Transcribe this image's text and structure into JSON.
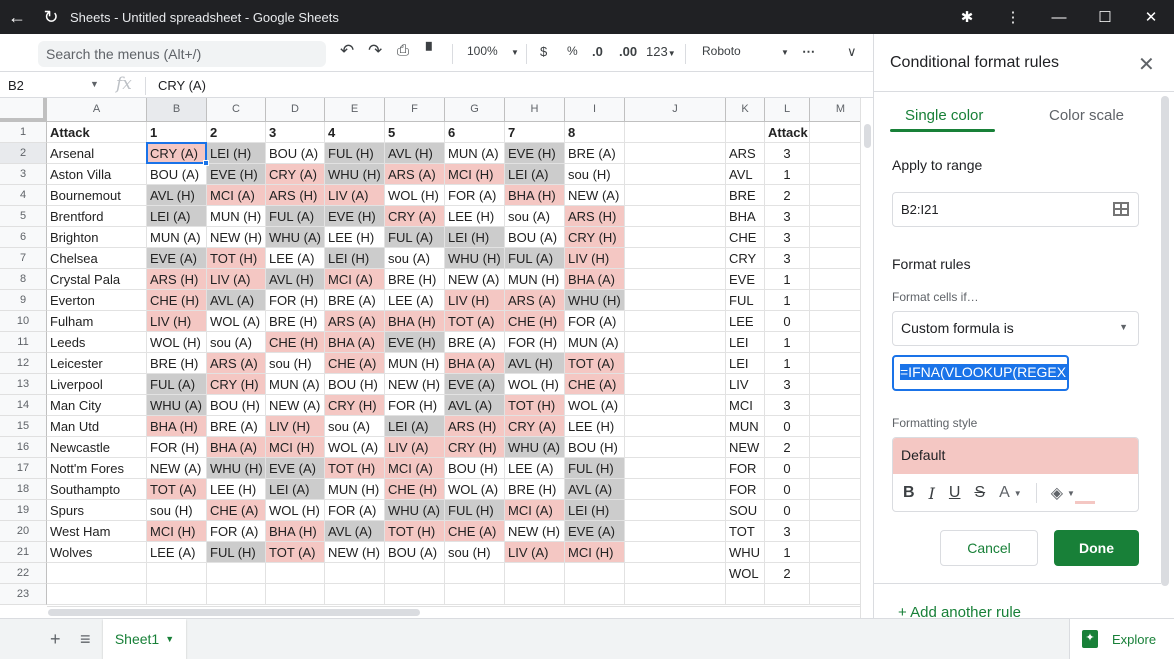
{
  "window": {
    "title": "Sheets - Untitled spreadsheet - Google Sheets",
    "icons": [
      "back-arrow-icon",
      "reload-icon",
      "extensions-icon",
      "more-vert-icon",
      "minimize-icon",
      "maximize-icon",
      "close-icon"
    ]
  },
  "toolbar": {
    "search_placeholder": "Search the menus (Alt+/)",
    "zoom": "100%",
    "currency": "$",
    "percent": "%",
    "decrease_decimal": ".0",
    "increase_decimal": ".00",
    "number_format": "123",
    "font": "Roboto",
    "more": "⋯",
    "collapse": "∨"
  },
  "formula_bar": {
    "name_box": "B2",
    "fx": "fx",
    "value": "CRY (A)"
  },
  "grid": {
    "columns": [
      "A",
      "B",
      "C",
      "D",
      "E",
      "F",
      "G",
      "H",
      "I",
      "J",
      "K",
      "L",
      "M"
    ],
    "selected_column": "B",
    "selected_row": 2,
    "row_numbers": [
      1,
      2,
      3,
      4,
      5,
      6,
      7,
      8,
      9,
      10,
      11,
      12,
      13,
      14,
      15,
      16,
      17,
      18,
      19,
      20,
      21,
      22,
      23
    ],
    "header_row": [
      "Attack",
      "1",
      "2",
      "3",
      "4",
      "5",
      "6",
      "7",
      "8"
    ],
    "fixture_rows": [
      {
        "team": "Arsenal",
        "cells": [
          [
            "CRY (A)",
            "p"
          ],
          [
            "LEI (H)",
            "g"
          ],
          [
            "BOU (A)",
            ""
          ],
          [
            "FUL (H)",
            "g"
          ],
          [
            "AVL (H)",
            "g"
          ],
          [
            "MUN (A)",
            ""
          ],
          [
            "EVE (H)",
            "g"
          ],
          [
            "BRE (A)",
            ""
          ]
        ]
      },
      {
        "team": "Aston Villa",
        "cells": [
          [
            "BOU (A)",
            ""
          ],
          [
            "EVE (H)",
            "g"
          ],
          [
            "CRY (A)",
            "p"
          ],
          [
            "WHU (H)",
            "g"
          ],
          [
            "ARS (A)",
            "p"
          ],
          [
            "MCI (H)",
            "p"
          ],
          [
            "LEI (A)",
            "g"
          ],
          [
            "sou (H)",
            ""
          ]
        ]
      },
      {
        "team": "Bournemout",
        "cells": [
          [
            "AVL (H)",
            "g"
          ],
          [
            "MCI (A)",
            "p"
          ],
          [
            "ARS (H)",
            "p"
          ],
          [
            "LIV (A)",
            "p"
          ],
          [
            "WOL (H)",
            ""
          ],
          [
            "FOR (A)",
            ""
          ],
          [
            "BHA (H)",
            "p"
          ],
          [
            "NEW (A)",
            ""
          ]
        ]
      },
      {
        "team": "Brentford",
        "cells": [
          [
            "LEI (A)",
            "g"
          ],
          [
            "MUN (H)",
            ""
          ],
          [
            "FUL (A)",
            "g"
          ],
          [
            "EVE (H)",
            "g"
          ],
          [
            "CRY (A)",
            "p"
          ],
          [
            "LEE (H)",
            ""
          ],
          [
            "sou (A)",
            ""
          ],
          [
            "ARS (H)",
            "p"
          ]
        ]
      },
      {
        "team": "Brighton",
        "cells": [
          [
            "MUN (A)",
            ""
          ],
          [
            "NEW (H)",
            ""
          ],
          [
            "WHU (A)",
            "g"
          ],
          [
            "LEE (H)",
            ""
          ],
          [
            "FUL (A)",
            "g"
          ],
          [
            "LEI (H)",
            "g"
          ],
          [
            "BOU (A)",
            ""
          ],
          [
            "CRY (H)",
            "p"
          ]
        ]
      },
      {
        "team": "Chelsea",
        "cells": [
          [
            "EVE (A)",
            "g"
          ],
          [
            "TOT (H)",
            "p"
          ],
          [
            "LEE (A)",
            ""
          ],
          [
            "LEI (H)",
            "g"
          ],
          [
            "sou (A)",
            ""
          ],
          [
            "WHU (H)",
            "g"
          ],
          [
            "FUL (A)",
            "g"
          ],
          [
            "LIV (H)",
            "p"
          ]
        ]
      },
      {
        "team": "Crystal Pala",
        "cells": [
          [
            "ARS (H)",
            "p"
          ],
          [
            "LIV (A)",
            "p"
          ],
          [
            "AVL (H)",
            "g"
          ],
          [
            "MCI (A)",
            "p"
          ],
          [
            "BRE (H)",
            ""
          ],
          [
            "NEW (A)",
            ""
          ],
          [
            "MUN (H)",
            ""
          ],
          [
            "BHA (A)",
            "p"
          ]
        ]
      },
      {
        "team": "Everton",
        "cells": [
          [
            "CHE (H)",
            "p"
          ],
          [
            "AVL (A)",
            "g"
          ],
          [
            "FOR (H)",
            ""
          ],
          [
            "BRE (A)",
            ""
          ],
          [
            "LEE (A)",
            ""
          ],
          [
            "LIV (H)",
            "p"
          ],
          [
            "ARS (A)",
            "p"
          ],
          [
            "WHU (H)",
            "g"
          ]
        ]
      },
      {
        "team": "Fulham",
        "cells": [
          [
            "LIV (H)",
            "p"
          ],
          [
            "WOL (A)",
            ""
          ],
          [
            "BRE (H)",
            ""
          ],
          [
            "ARS (A)",
            "p"
          ],
          [
            "BHA (H)",
            "p"
          ],
          [
            "TOT (A)",
            "p"
          ],
          [
            "CHE (H)",
            "p"
          ],
          [
            "FOR (A)",
            ""
          ]
        ]
      },
      {
        "team": "Leeds",
        "cells": [
          [
            "WOL (H)",
            ""
          ],
          [
            "sou (A)",
            ""
          ],
          [
            "CHE (H)",
            "p"
          ],
          [
            "BHA (A)",
            "p"
          ],
          [
            "EVE (H)",
            "g"
          ],
          [
            "BRE (A)",
            ""
          ],
          [
            "FOR (H)",
            ""
          ],
          [
            "MUN (A)",
            ""
          ]
        ]
      },
      {
        "team": "Leicester",
        "cells": [
          [
            "BRE (H)",
            ""
          ],
          [
            "ARS (A)",
            "p"
          ],
          [
            "sou (H)",
            ""
          ],
          [
            "CHE (A)",
            "p"
          ],
          [
            "MUN (H)",
            ""
          ],
          [
            "BHA (A)",
            "p"
          ],
          [
            "AVL (H)",
            "g"
          ],
          [
            "TOT (A)",
            "p"
          ]
        ]
      },
      {
        "team": "Liverpool",
        "cells": [
          [
            "FUL (A)",
            "g"
          ],
          [
            "CRY (H)",
            "p"
          ],
          [
            "MUN (A)",
            ""
          ],
          [
            "BOU (H)",
            ""
          ],
          [
            "NEW (H)",
            ""
          ],
          [
            "EVE (A)",
            "g"
          ],
          [
            "WOL (H)",
            ""
          ],
          [
            "CHE (A)",
            "p"
          ]
        ]
      },
      {
        "team": "Man City",
        "cells": [
          [
            "WHU (A)",
            "g"
          ],
          [
            "BOU (H)",
            ""
          ],
          [
            "NEW (A)",
            ""
          ],
          [
            "CRY (H)",
            "p"
          ],
          [
            "FOR (H)",
            ""
          ],
          [
            "AVL (A)",
            "g"
          ],
          [
            "TOT (H)",
            "p"
          ],
          [
            "WOL (A)",
            ""
          ]
        ]
      },
      {
        "team": "Man Utd",
        "cells": [
          [
            "BHA (H)",
            "p"
          ],
          [
            "BRE (A)",
            ""
          ],
          [
            "LIV (H)",
            "p"
          ],
          [
            "sou (A)",
            ""
          ],
          [
            "LEI (A)",
            "g"
          ],
          [
            "ARS (H)",
            "p"
          ],
          [
            "CRY (A)",
            "p"
          ],
          [
            "LEE (H)",
            ""
          ]
        ]
      },
      {
        "team": "Newcastle",
        "cells": [
          [
            "FOR (H)",
            ""
          ],
          [
            "BHA (A)",
            "p"
          ],
          [
            "MCI (H)",
            "p"
          ],
          [
            "WOL (A)",
            ""
          ],
          [
            "LIV (A)",
            "p"
          ],
          [
            "CRY (H)",
            "p"
          ],
          [
            "WHU (A)",
            "g"
          ],
          [
            "BOU (H)",
            ""
          ]
        ]
      },
      {
        "team": "Nott'm Fores",
        "cells": [
          [
            "NEW (A)",
            ""
          ],
          [
            "WHU (H)",
            "g"
          ],
          [
            "EVE (A)",
            "g"
          ],
          [
            "TOT (H)",
            "p"
          ],
          [
            "MCI (A)",
            "p"
          ],
          [
            "BOU (H)",
            ""
          ],
          [
            "LEE (A)",
            ""
          ],
          [
            "FUL (H)",
            "g"
          ]
        ]
      },
      {
        "team": "Southampto",
        "cells": [
          [
            "TOT (A)",
            "p"
          ],
          [
            "LEE (H)",
            ""
          ],
          [
            "LEI (A)",
            "g"
          ],
          [
            "MUN (H)",
            ""
          ],
          [
            "CHE (H)",
            "p"
          ],
          [
            "WOL (A)",
            ""
          ],
          [
            "BRE (H)",
            ""
          ],
          [
            "AVL (A)",
            "g"
          ]
        ]
      },
      {
        "team": "Spurs",
        "cells": [
          [
            "sou (H)",
            ""
          ],
          [
            "CHE (A)",
            "p"
          ],
          [
            "WOL (H)",
            ""
          ],
          [
            "FOR (A)",
            ""
          ],
          [
            "WHU (A)",
            "g"
          ],
          [
            "FUL (H)",
            "g"
          ],
          [
            "MCI (A)",
            "p"
          ],
          [
            "LEI (H)",
            "g"
          ]
        ]
      },
      {
        "team": "West Ham",
        "cells": [
          [
            "MCI (H)",
            "p"
          ],
          [
            "FOR (A)",
            ""
          ],
          [
            "BHA (H)",
            "p"
          ],
          [
            "AVL (A)",
            "g"
          ],
          [
            "TOT (H)",
            "p"
          ],
          [
            "CHE (A)",
            "p"
          ],
          [
            "NEW (H)",
            ""
          ],
          [
            "EVE (A)",
            "g"
          ]
        ]
      },
      {
        "team": "Wolves",
        "cells": [
          [
            "LEE (A)",
            ""
          ],
          [
            "FUL (H)",
            "g"
          ],
          [
            "TOT (A)",
            "p"
          ],
          [
            "NEW (H)",
            ""
          ],
          [
            "BOU (A)",
            ""
          ],
          [
            "sou (H)",
            ""
          ],
          [
            "LIV (A)",
            "p"
          ],
          [
            "MCI (H)",
            "p"
          ]
        ]
      }
    ],
    "lookup_header": "Attack",
    "lookup": [
      [
        "ARS",
        3
      ],
      [
        "AVL",
        1
      ],
      [
        "BRE",
        2
      ],
      [
        "BHA",
        3
      ],
      [
        "CHE",
        3
      ],
      [
        "CRY",
        3
      ],
      [
        "EVE",
        1
      ],
      [
        "FUL",
        1
      ],
      [
        "LEE",
        0
      ],
      [
        "LEI",
        1
      ],
      [
        "LEI",
        1
      ],
      [
        "LIV",
        3
      ],
      [
        "MCI",
        3
      ],
      [
        "MUN",
        0
      ],
      [
        "NEW",
        2
      ],
      [
        "FOR",
        0
      ],
      [
        "FOR",
        0
      ],
      [
        "SOU",
        0
      ],
      [
        "TOT",
        3
      ],
      [
        "WHU",
        1
      ],
      [
        "WOL",
        2
      ]
    ],
    "fill_colors": {
      "p": "#f4c7c3",
      "g": "#cccccc"
    }
  },
  "sheets": {
    "tabs": [
      {
        "label": "Sheet1",
        "active": true
      }
    ],
    "explore_label": "Explore"
  },
  "panel": {
    "title": "Conditional format rules",
    "tabs": [
      {
        "label": "Single color",
        "active": true
      },
      {
        "label": "Color scale",
        "active": false
      }
    ],
    "apply_to_range_label": "Apply to range",
    "range_value": "B2:I21",
    "format_rules_label": "Format rules",
    "format_cells_if_label": "Format cells if…",
    "condition": "Custom formula is",
    "formula_value": "=IFNA(VLOOKUP(REGEXE",
    "formatting_style_label": "Formatting style",
    "style_preset": "Default",
    "style_fill_color": "#f4c7c3",
    "style_tools": {
      "bold": "B",
      "italic": "I",
      "underline": "U",
      "strikethrough": "S",
      "text_color": "A"
    },
    "cancel_label": "Cancel",
    "done_label": "Done",
    "add_rule_label": "+ Add another rule"
  }
}
